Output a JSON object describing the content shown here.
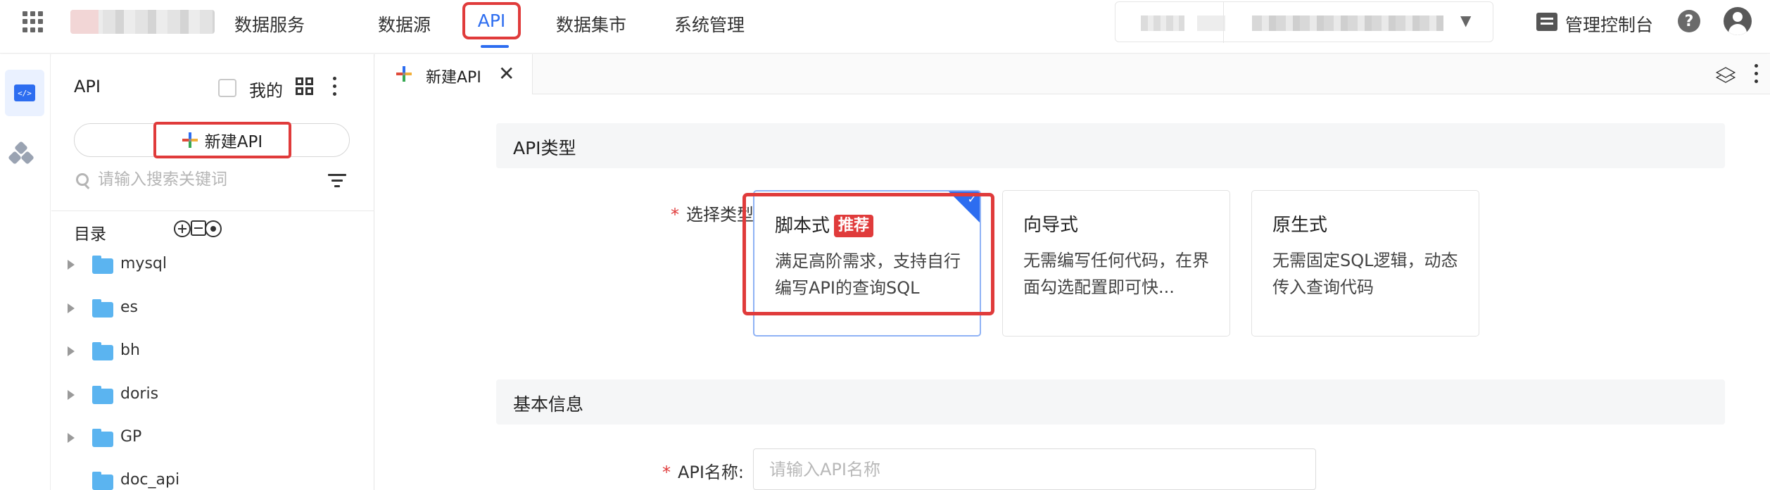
{
  "topbar": {
    "brand": "数据服务",
    "nav": [
      "数据源",
      "API",
      "数据集市",
      "系统管理"
    ],
    "active_nav": "API",
    "console_label": "管理控制台",
    "help_symbol": "?"
  },
  "rail": {
    "api_icon_text": "</>"
  },
  "sidebar": {
    "title": "API",
    "mine_label": "我的",
    "new_button_label": "新建API",
    "search_placeholder": "请输入搜索关键词",
    "directory_label": "目录",
    "tree": [
      {
        "label": "mysql"
      },
      {
        "label": "es"
      },
      {
        "label": "bh"
      },
      {
        "label": "doris"
      },
      {
        "label": "GP"
      },
      {
        "label": "doc_api"
      }
    ]
  },
  "tabs": [
    {
      "label": "新建API",
      "close": "✕"
    }
  ],
  "form": {
    "section_api_type": "API类型",
    "select_type_label": "选择类型",
    "required_mark": "*",
    "types": [
      {
        "title": "脚本式",
        "badge": "推荐",
        "desc": "满足高阶需求，支持自行编写API的查询SQL",
        "selected": true
      },
      {
        "title": "向导式",
        "desc": "无需编写任何代码，在界面勾选配置即可快...",
        "selected": false
      },
      {
        "title": "原生式",
        "desc": "无需固定SQL逻辑，动态传入查询代码",
        "selected": false
      }
    ],
    "section_basic_info": "基本信息",
    "api_name_label": "API名称:",
    "api_name_placeholder": "请输入API名称"
  },
  "colors": {
    "accent": "#2d6df0",
    "highlight": "#e03b3b",
    "folder": "#5bb4f0"
  }
}
